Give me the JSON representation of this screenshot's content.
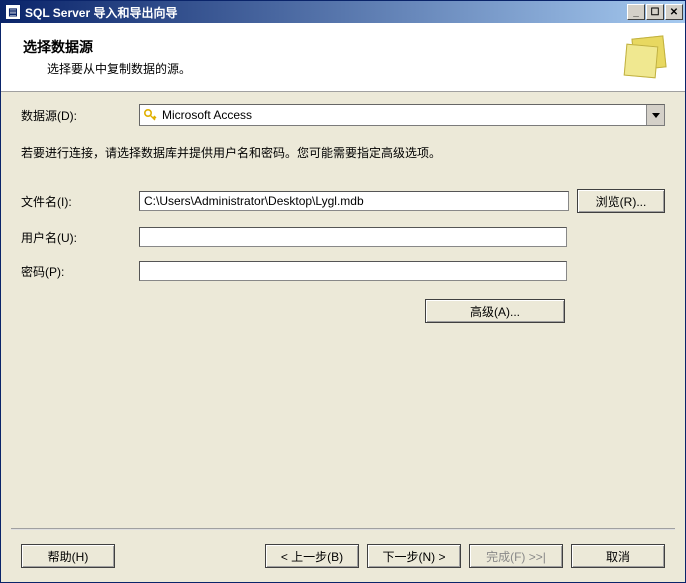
{
  "window": {
    "title": "SQL Server 导入和导出向导"
  },
  "header": {
    "title": "选择数据源",
    "subtitle": "选择要从中复制数据的源。"
  },
  "datasource": {
    "label": "数据源(D):",
    "value": "Microsoft Access"
  },
  "instruction": "若要进行连接，请选择数据库并提供用户名和密码。您可能需要指定高级选项。",
  "file": {
    "label": "文件名(I):",
    "value": "C:\\Users\\Administrator\\Desktop\\Lygl.mdb",
    "browse": "浏览(R)..."
  },
  "user": {
    "label": "用户名(U):",
    "value": ""
  },
  "password": {
    "label": "密码(P):",
    "value": ""
  },
  "advanced": "高级(A)...",
  "footer": {
    "help": "帮助(H)",
    "back": "< 上一步(B)",
    "next": "下一步(N) >",
    "finish": "完成(F) >>|",
    "cancel": "取消"
  }
}
